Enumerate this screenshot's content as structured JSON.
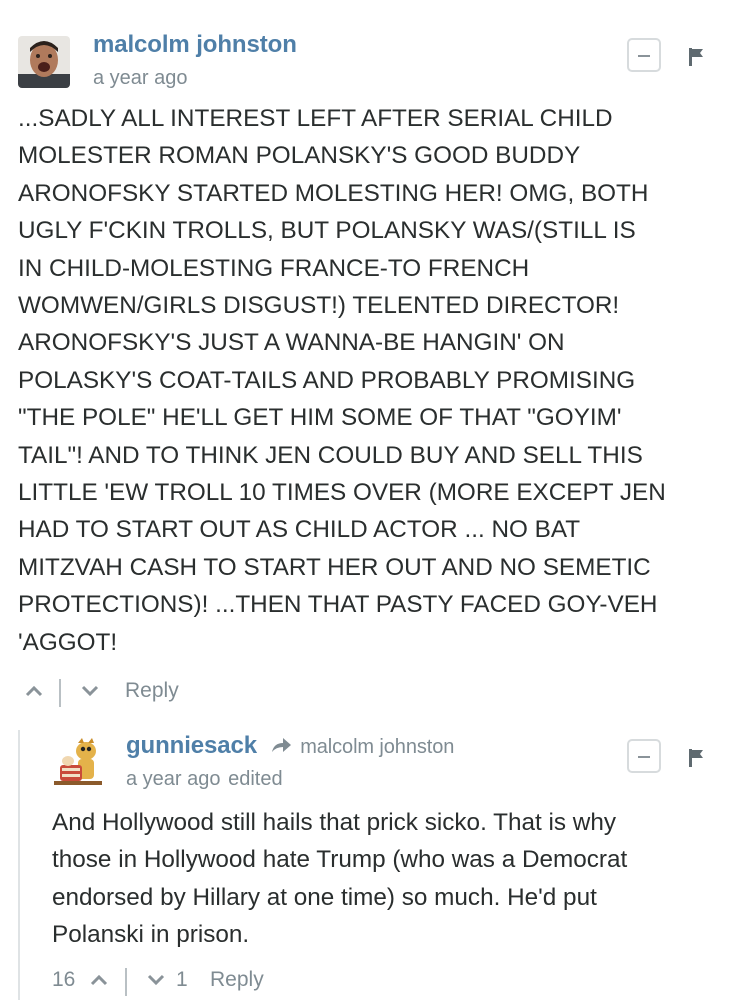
{
  "comments": [
    {
      "author": "malcolm johnston",
      "timestamp": "a year ago",
      "text": "...SADLY ALL INTEREST LEFT AFTER SERIAL CHILD\nMOLESTER ROMAN POLANSKY'S GOOD BUDDY\nARONOFSKY STARTED MOLESTING HER! OMG, BOTH\nUGLY F'CKIN TROLLS, BUT POLANSKY WAS/(STILL IS\nIN CHILD-MOLESTING FRANCE-TO FRENCH\nWOMWEN/GIRLS DISGUST!) TELENTED DIRECTOR!\nARONOFSKY'S JUST A WANNA-BE HANGIN' ON\nPOLASKY'S COAT-TAILS AND PROBABLY PROMISING\n\"THE POLE\" HE'LL GET HIM SOME OF THAT \"GOYIM'\nTAIL\"! AND TO THINK JEN COULD BUY AND SELL THIS\nLITTLE 'EW TROLL 10 TIMES OVER (MORE EXCEPT JEN\nHAD TO START OUT AS CHILD ACTOR ... NO BAT\nMITZVAH CASH TO START HER OUT AND NO SEMETIC\nPROTECTIONS)! ...THEN THAT PASTY FACED GOY-VEH\n'AGGOT!",
      "reply_label": "Reply"
    },
    {
      "author": "gunniesack",
      "in_reply_to": "malcolm johnston",
      "timestamp": "a year ago",
      "edited_label": "edited",
      "text": "And Hollywood still hails that prick sicko. That is why\nthose in Hollywood hate Trump (who was a Democrat\nendorsed by Hillary at one time) so much. He'd put\nPolanski in prison.",
      "upvotes": "16",
      "downvotes": "1",
      "reply_label": "Reply"
    }
  ],
  "icons": {
    "upvote": "chevron-up-icon",
    "downvote": "chevron-down-icon",
    "flag": "flag-icon",
    "collapse": "minus-icon",
    "reply_to": "share-arrow-icon"
  },
  "colors": {
    "author": "#4f7fa8",
    "meta": "#7f8b92",
    "text": "#2a2e2e"
  }
}
